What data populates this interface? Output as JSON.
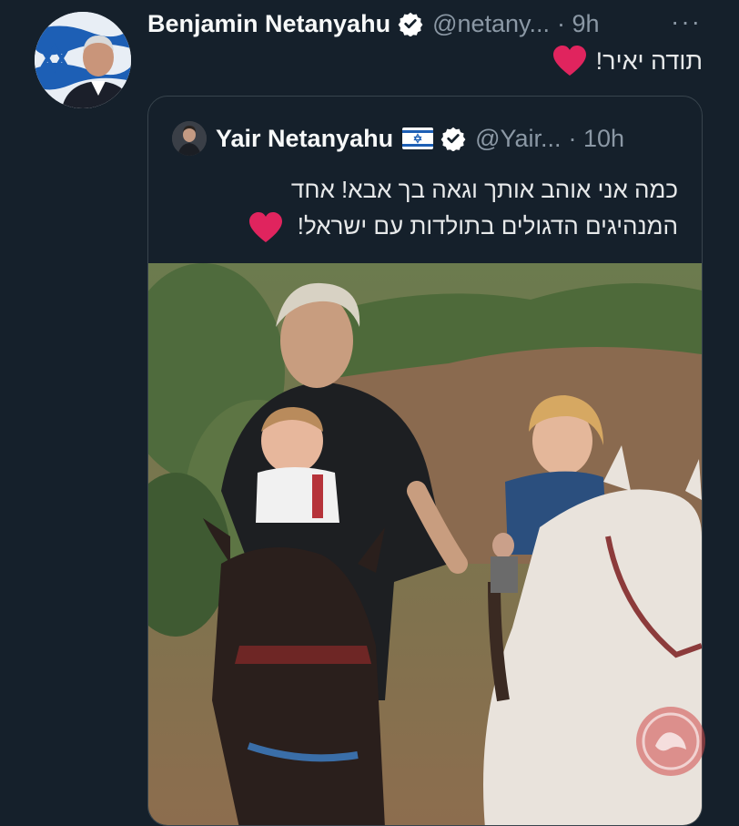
{
  "author": {
    "name": "Benjamin Netanyahu",
    "handle": "@netany...",
    "time": "· 9h",
    "more_icon": "···",
    "verified_icon": "verified-badge-icon",
    "avatar_icon": "profile-avatar-with-israeli-flag"
  },
  "tweet": {
    "text": "תודה יאיר!",
    "emoji": "heart-emoji"
  },
  "quoted": {
    "name": "Yair Netanyahu",
    "flag": "israel-flag-emoji",
    "handle": "@Yair...",
    "time": "· 10h",
    "line1": "כמה אני אוהב אותך וגאה בך אבא! אחד",
    "line2": "המנהיגים הדגולים בתולדות עם ישראל!",
    "photo_description": "photo-of-family-horseback-riding"
  },
  "colors": {
    "background": "#15202b",
    "border": "#38444d",
    "secondary_text": "#8b98a5",
    "verified": "#ffffff",
    "heart": "#e0245e"
  }
}
